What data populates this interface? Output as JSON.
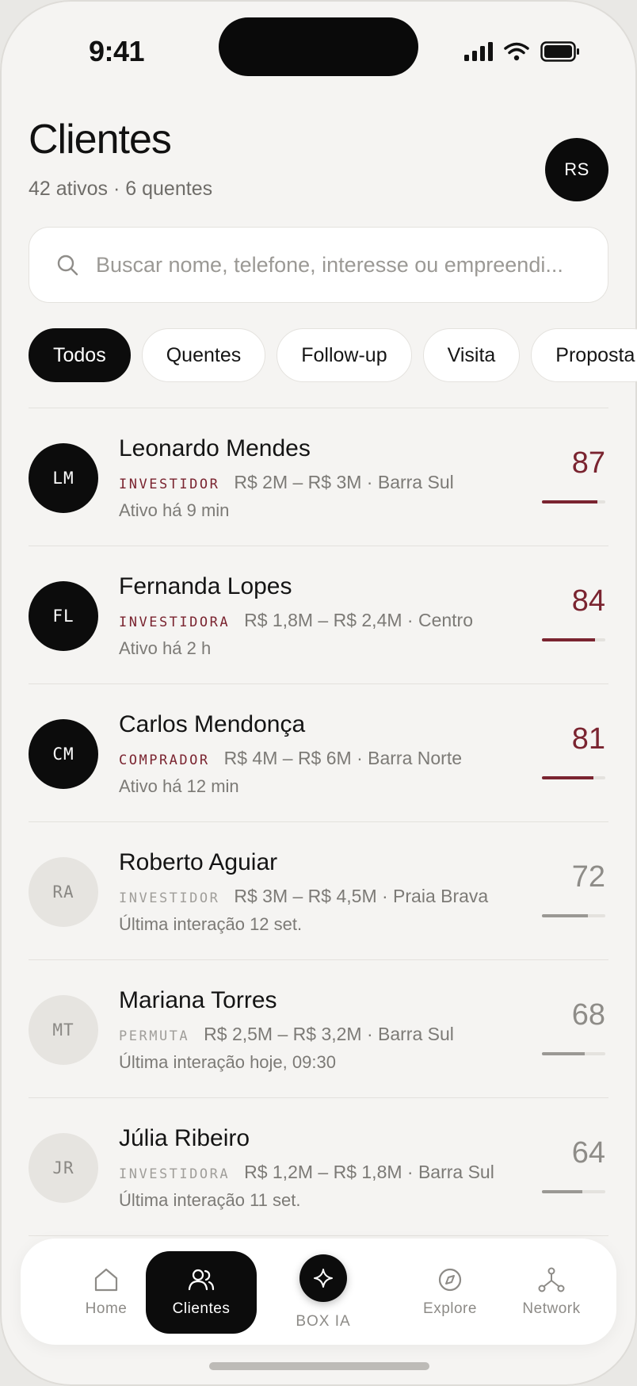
{
  "status_bar": {
    "time": "9:41"
  },
  "header": {
    "title": "Clientes",
    "subtitle": "42 ativos · 6 quentes",
    "avatar_initials": "RS"
  },
  "search": {
    "placeholder": "Buscar nome, telefone, interesse ou empreendi..."
  },
  "filters": [
    {
      "label": "Todos",
      "active": true
    },
    {
      "label": "Quentes",
      "active": false
    },
    {
      "label": "Follow-up",
      "active": false
    },
    {
      "label": "Visita",
      "active": false
    },
    {
      "label": "Proposta",
      "active": false
    }
  ],
  "clients": [
    {
      "initials": "LM",
      "name": "Leonardo Mendes",
      "tag": "INVESTIDOR",
      "range": "R$ 2M – R$ 3M · Barra Sul",
      "activity": "Ativo há 9 min",
      "score": 87,
      "hot": true
    },
    {
      "initials": "FL",
      "name": "Fernanda Lopes",
      "tag": "INVESTIDORA",
      "range": "R$ 1,8M – R$ 2,4M · Centro",
      "activity": "Ativo há 2 h",
      "score": 84,
      "hot": true
    },
    {
      "initials": "CM",
      "name": "Carlos Mendonça",
      "tag": "COMPRADOR",
      "range": "R$ 4M – R$ 6M · Barra Norte",
      "activity": "Ativo há 12 min",
      "score": 81,
      "hot": true
    },
    {
      "initials": "RA",
      "name": "Roberto Aguiar",
      "tag": "INVESTIDOR",
      "range": "R$ 3M – R$ 4,5M · Praia Brava",
      "activity": "Última interação 12 set.",
      "score": 72,
      "hot": false
    },
    {
      "initials": "MT",
      "name": "Mariana Torres",
      "tag": "PERMUTA",
      "range": "R$ 2,5M – R$ 3,2M · Barra Sul",
      "activity": "Última interação hoje, 09:30",
      "score": 68,
      "hot": false
    },
    {
      "initials": "JR",
      "name": "Júlia Ribeiro",
      "tag": "INVESTIDORA",
      "range": "R$ 1,2M – R$ 1,8M · Barra Sul",
      "activity": "Última interação 11 set.",
      "score": 64,
      "hot": false
    }
  ],
  "tabbar": {
    "home": "Home",
    "clientes": "Clientes",
    "box_ia": "BOX IA",
    "explore": "Explore",
    "network": "Network"
  },
  "colors": {
    "accent_hot": "#7a2430",
    "dark": "#0c0c0c",
    "background": "#f5f4f2"
  }
}
